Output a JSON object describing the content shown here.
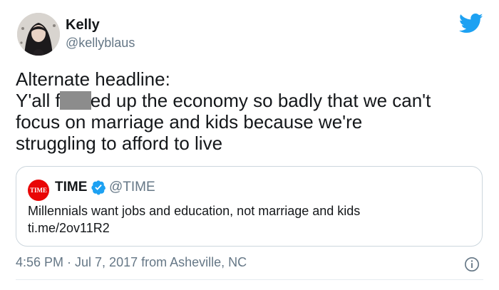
{
  "author": {
    "name": "Kelly",
    "handle": "@kellyblaus"
  },
  "tweet": {
    "line1": "Alternate headline:",
    "line2_before": "Y'all f",
    "line2_after": "ed up the economy so badly that we can't",
    "line3": "focus on marriage and kids because we're",
    "line4": "struggling to afford to live"
  },
  "quoted_tweet": {
    "logo_text": "TIME",
    "name": "TIME",
    "handle": "@TIME",
    "text": "Millennials want jobs and education, not marriage and kids",
    "link": "ti.me/2ov11R2"
  },
  "meta": {
    "timestamp": "4:56 PM · Jul 7, 2017 from Asheville, NC"
  },
  "icons": {
    "brand": "twitter-bird-icon",
    "verified": "verified-badge-icon",
    "info": "info-icon"
  },
  "colors": {
    "twitter_blue": "#1da1f2",
    "time_red": "#e90606",
    "muted_text": "#657786",
    "censor_gray": "#8c8c8c"
  }
}
